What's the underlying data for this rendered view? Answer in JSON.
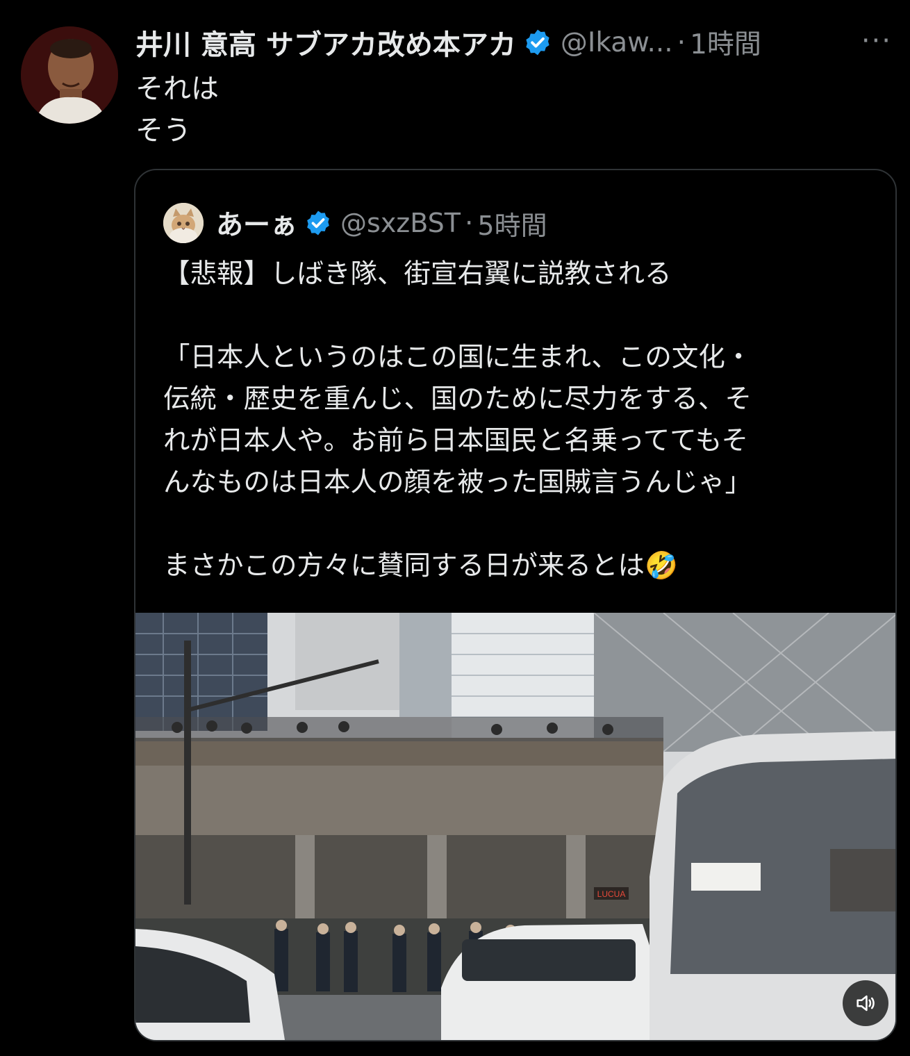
{
  "tweet": {
    "author_name": "井川 意高 サブアカ改め本アカ",
    "handle": "@Ikaw...",
    "separator": "·",
    "time": "1時間",
    "more_label": "···",
    "text_lines": [
      "それは",
      "そう"
    ]
  },
  "quoted": {
    "author_name": "あーぁ",
    "handle": "@sxzBST",
    "separator": "·",
    "time": "5時間",
    "lines": [
      "【悲報】しばき隊、街宣右翼に説教される",
      "",
      "「日本人というのはこの国に生まれ、この文化・",
      "伝統・歴史を重んじ、国のために尽力をする、そ",
      "れが日本人や。お前ら日本国民と名乗っててもそ",
      "んなものは日本人の顔を被った国賊言うんじゃ」",
      "",
      "まさかこの方々に賛同する日が来るとは🤣"
    ],
    "media": {
      "type": "video",
      "sign_text": "LUCUA"
    }
  },
  "colors": {
    "background": "#000000",
    "text_primary": "#e7e9ea",
    "text_secondary": "#8b8f93",
    "verified": "#1d9bf0",
    "border": "#2f3336"
  },
  "icons": {
    "verified": "verified-badge-icon",
    "more": "more-dots-icon",
    "sound": "volume-muted-icon"
  }
}
